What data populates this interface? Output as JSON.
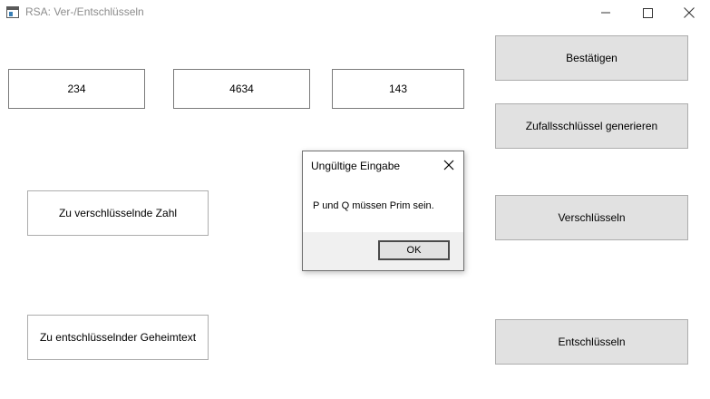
{
  "window": {
    "title": "RSA: Ver-/Entschlüsseln",
    "controls": [
      "minimize-icon",
      "maximize-icon",
      "close-icon"
    ]
  },
  "fields": {
    "p_value": "234",
    "q_value": "4634",
    "e_value": "143",
    "plaintext_label": "Zu verschlüsselnde Zahl",
    "ciphertext_label": "Zu entschlüsselnder Geheimtext"
  },
  "buttons": {
    "confirm": "Bestätigen",
    "random_key": "Zufallsschlüssel generieren",
    "encrypt": "Verschlüsseln",
    "decrypt": "Entschlüsseln"
  },
  "dialog": {
    "title": "Ungültige Eingabe",
    "message": "P und Q müssen Prim sein.",
    "ok_label": "OK"
  },
  "colors": {
    "button_face": "#e1e1e1",
    "button_border": "#adadad",
    "title_text": "#8c8c8c"
  }
}
